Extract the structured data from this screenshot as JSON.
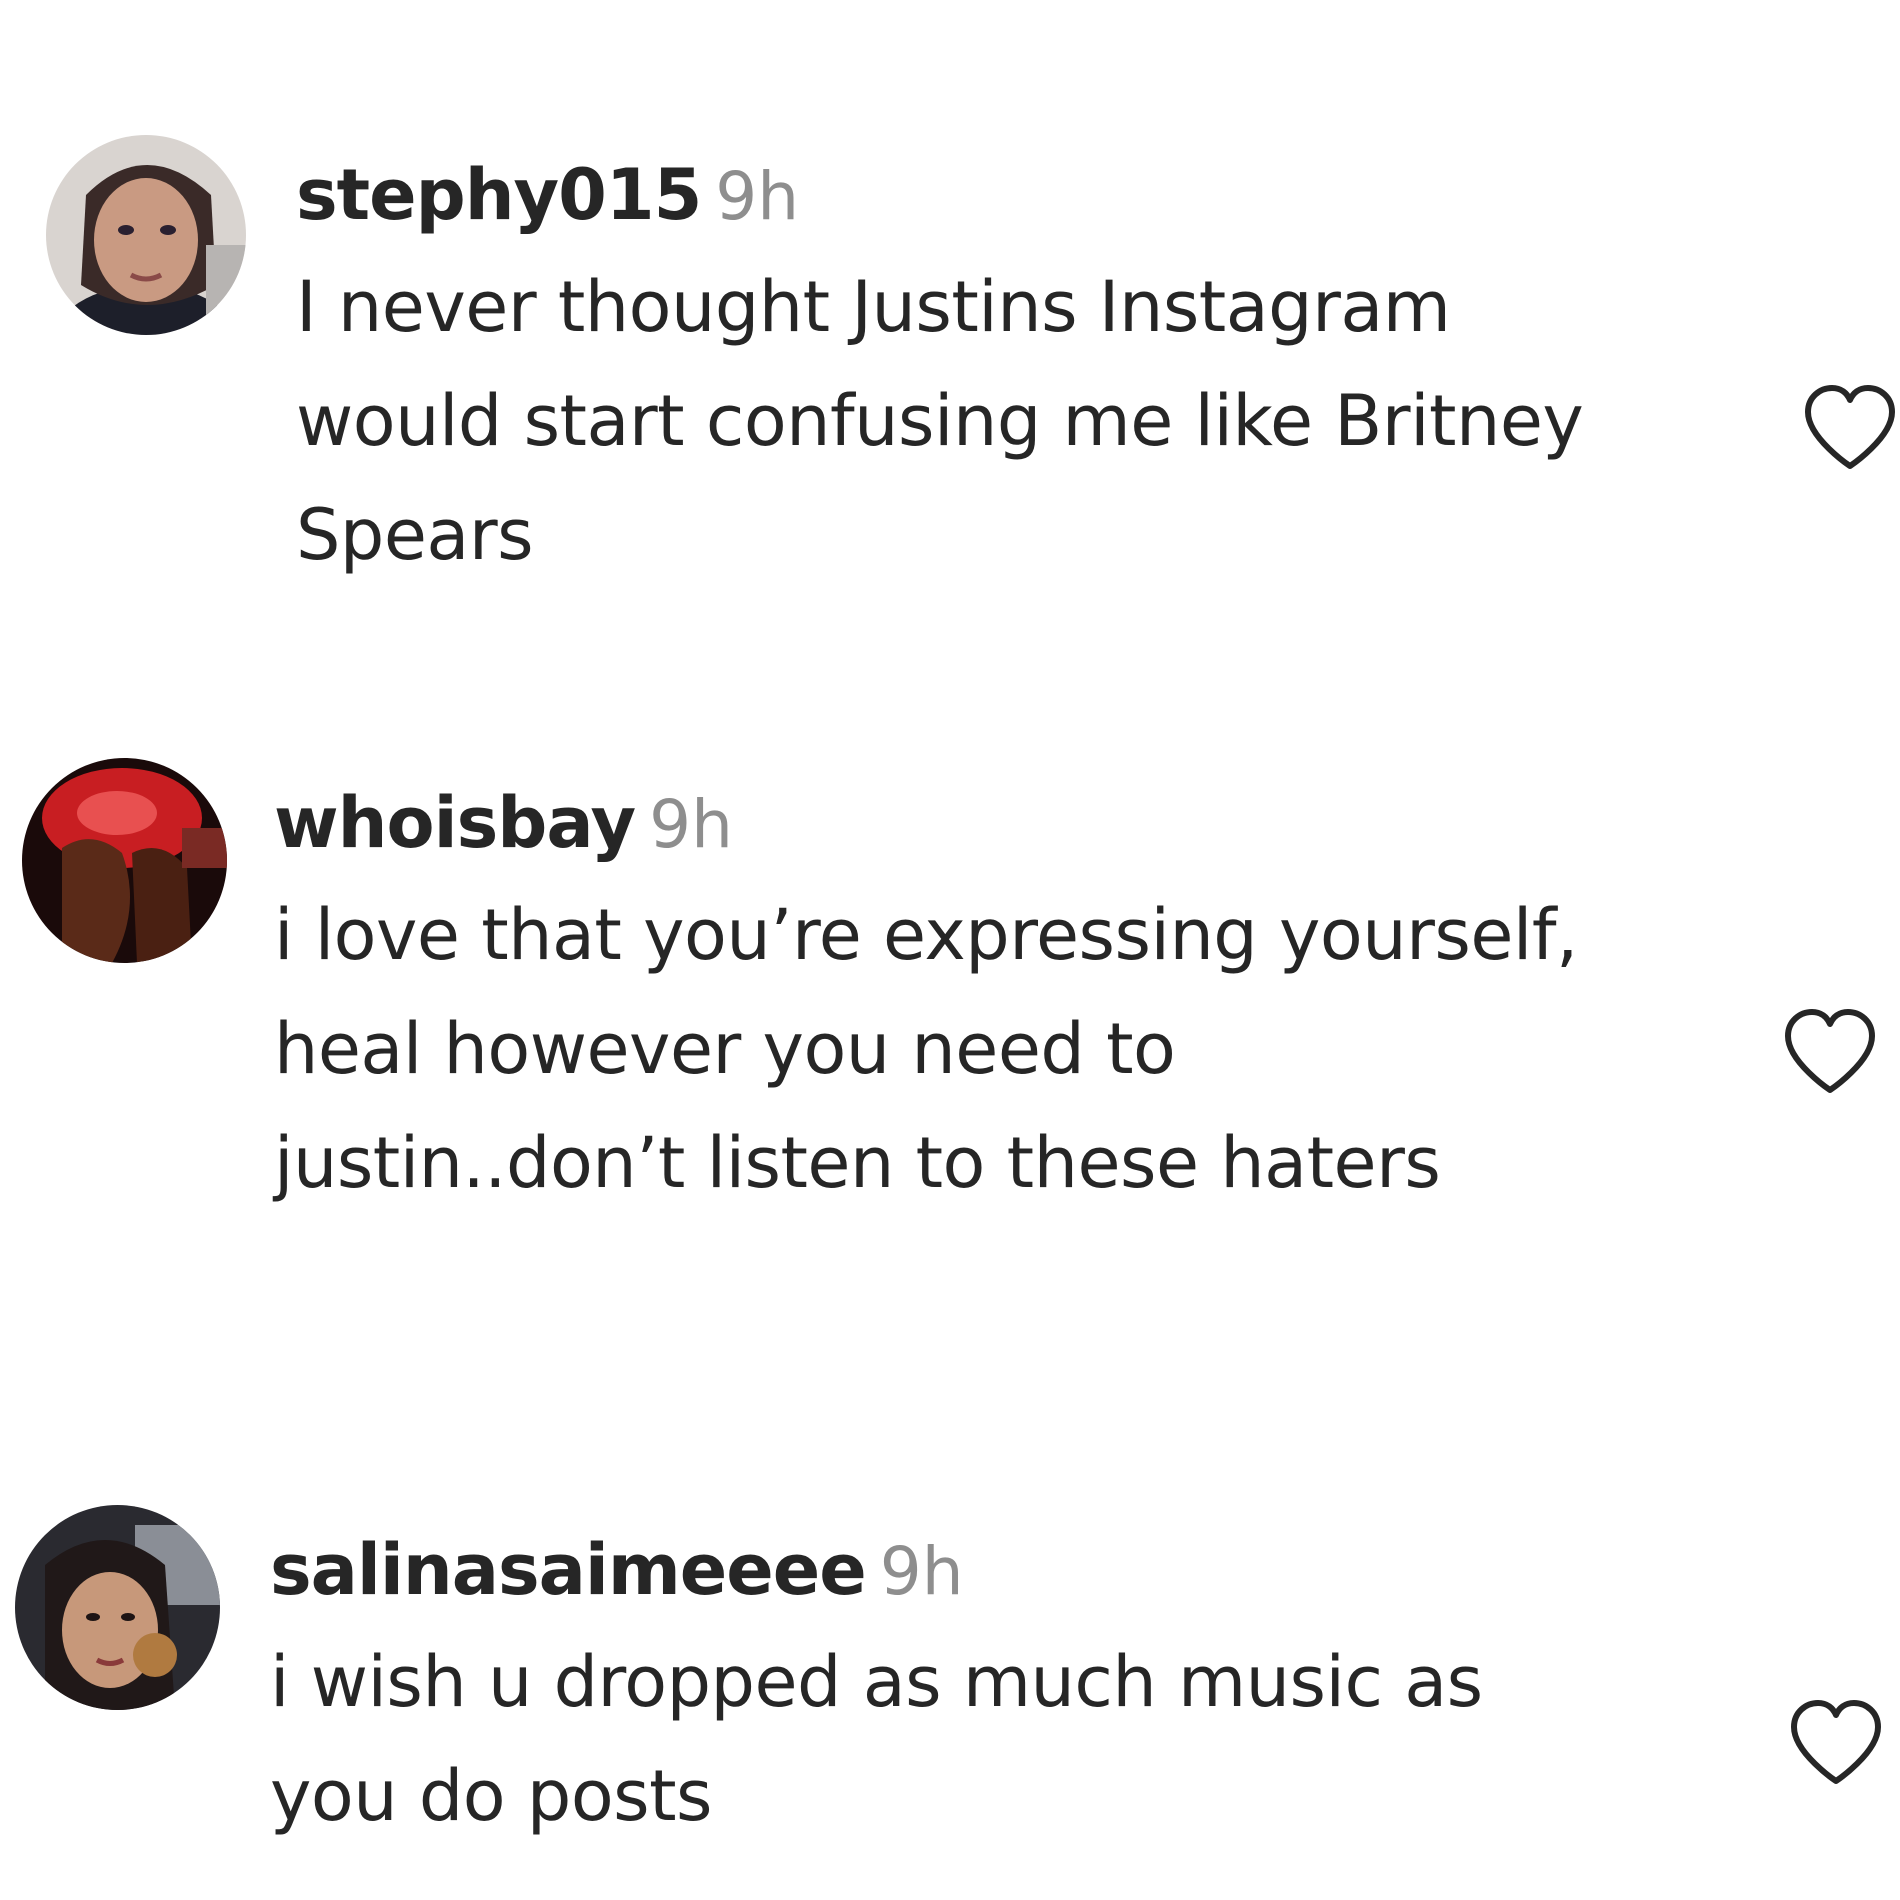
{
  "comments": [
    {
      "username": "stephy015",
      "time": "9h",
      "text": "I never thought Justins Instagram\nwould start confusing me like Britney\nSpears",
      "avatar_icon": "user-avatar-photo",
      "like_icon": "heart-outline-icon"
    },
    {
      "username": "whoisbay",
      "time": "9h",
      "text": "i love that you’re expressing yourself,\nheal however you need to\njustin..don’t listen to these haters",
      "avatar_icon": "user-avatar-photo",
      "like_icon": "heart-outline-icon"
    },
    {
      "username": "salinasaimeeee",
      "time": "9h",
      "text": "i wish u dropped as much music as\nyou do posts",
      "avatar_icon": "user-avatar-photo",
      "like_icon": "heart-outline-icon"
    }
  ],
  "colors": {
    "text": "#262626",
    "timestamp": "#8e8e8e",
    "heart_stroke": "#262626"
  }
}
